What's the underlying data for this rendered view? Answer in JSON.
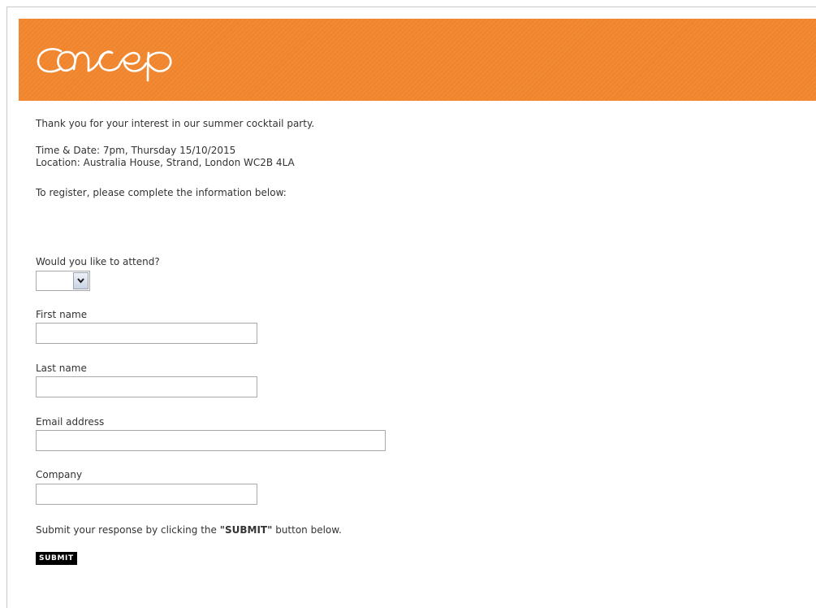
{
  "header": {
    "logo_text": "concep",
    "brand_color": "#f0852d"
  },
  "intro": {
    "thanks": "Thank you for your interest in our summer cocktail party.",
    "time_date": "Time & Date: 7pm, Thursday 15/10/2015",
    "location": "Location: Australia House, Strand, London WC2B 4LA",
    "register": "To register, please complete the information below:"
  },
  "form": {
    "attend": {
      "label": "Would you like to attend?",
      "value": ""
    },
    "first_name": {
      "label": "First name",
      "value": ""
    },
    "last_name": {
      "label": "Last name",
      "value": ""
    },
    "email": {
      "label": "Email address",
      "value": ""
    },
    "company": {
      "label": "Company",
      "value": ""
    },
    "submit_prefix": "Submit your response by clicking the ",
    "submit_emph": "\"SUBMIT\"",
    "submit_suffix": " button below.",
    "submit_label": "SUBMIT"
  }
}
